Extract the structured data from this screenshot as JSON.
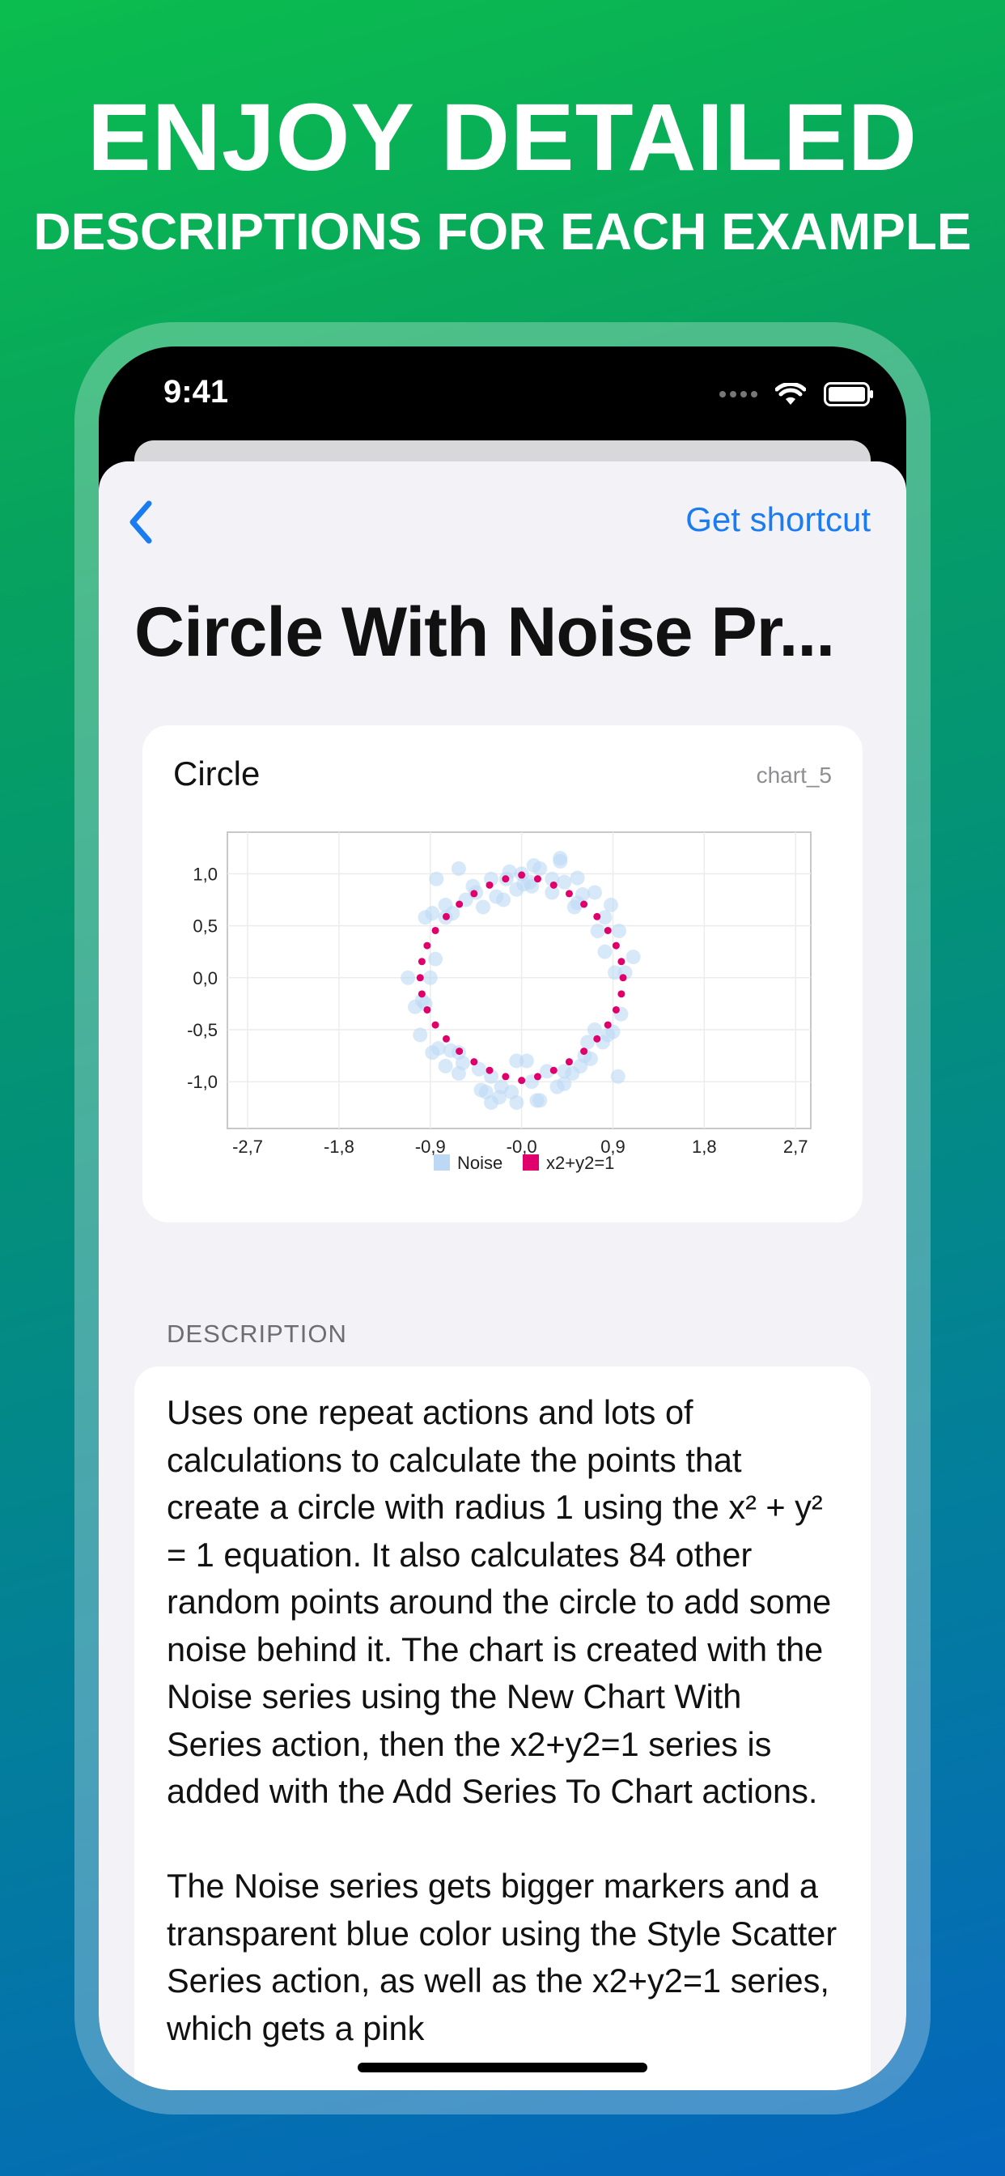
{
  "promo": {
    "title": "ENJOY DETAILED",
    "subtitle": "DESCRIPTIONS FOR EACH EXAMPLE"
  },
  "status_bar": {
    "time": "9:41"
  },
  "nav": {
    "back_icon": "chevron-left-icon",
    "shortcut_label": "Get shortcut"
  },
  "page": {
    "title": "Circle With Noise Pr..."
  },
  "card": {
    "title": "Circle",
    "id_label": "chart_5"
  },
  "colors": {
    "accent": "#1b7cf2",
    "noise": "#bcd8f5",
    "circle": "#e0006c"
  },
  "chart_data": {
    "type": "scatter",
    "title": "",
    "xlabel": "",
    "ylabel": "",
    "xlim": [
      -2.9,
      2.85
    ],
    "ylim": [
      -1.45,
      1.4
    ],
    "x_ticks": [
      -2.7,
      -1.8,
      -0.9,
      0.0,
      0.9,
      1.8,
      2.7
    ],
    "x_tick_labels": [
      "-2,7",
      "-1,8",
      "-0,9",
      "-0,0",
      "0,9",
      "1,8",
      "2,7"
    ],
    "y_ticks": [
      1.0,
      0.5,
      0.0,
      -0.5,
      -1.0
    ],
    "y_tick_labels": [
      "1,0",
      "0,5",
      "0,0",
      "-0,5",
      "-1,0"
    ],
    "grid": true,
    "legend": "bottom-center",
    "series": [
      {
        "name": "Noise",
        "color": "#bcd8f5",
        "x": [
          -0.84,
          -0.62,
          -0.95,
          -0.75,
          -0.45,
          -0.3,
          -0.12,
          0.02,
          0.18,
          0.38,
          0.55,
          0.72,
          0.88,
          0.96,
          0.82,
          0.6,
          0.42,
          0.12,
          -0.05,
          -0.38,
          -0.55,
          -0.85,
          -0.98,
          -1.12,
          -0.82,
          -1.0,
          -1.05,
          -0.75,
          -0.88,
          -0.62,
          -0.4,
          -0.22,
          -0.05,
          0.15,
          0.35,
          0.5,
          0.68,
          0.9,
          0.98,
          0.8,
          0.58,
          0.42,
          0.1,
          -0.2,
          -0.35,
          -0.7,
          -0.95,
          -0.3,
          0.05,
          0.25,
          -0.58,
          0.85,
          1.1,
          1.02,
          -0.15,
          0.3,
          0.55,
          -0.68,
          -0.9,
          0.0,
          0.1,
          0.3,
          0.75,
          0.62,
          0.95,
          -0.48,
          -0.25,
          -0.75,
          -0.62,
          0.42,
          0.72,
          0.82,
          -0.1,
          0.18,
          -0.42,
          0.52,
          -0.88,
          0.92,
          -0.3,
          0.38,
          0.08,
          -0.18,
          0.65,
          -0.05
        ],
        "y": [
          0.95,
          1.05,
          0.58,
          0.7,
          0.82,
          0.95,
          1.02,
          0.9,
          1.05,
          1.12,
          0.96,
          0.82,
          0.7,
          0.45,
          0.58,
          0.8,
          0.92,
          1.08,
          0.85,
          0.68,
          0.75,
          0.18,
          -0.22,
          0.0,
          -0.68,
          -0.55,
          -0.28,
          -0.85,
          -0.72,
          -0.92,
          -1.08,
          -1.15,
          -1.2,
          -1.18,
          -1.05,
          -0.92,
          -0.78,
          -0.52,
          -0.35,
          -0.62,
          -0.85,
          -1.02,
          -1.0,
          -1.05,
          -1.1,
          -0.7,
          -0.25,
          -0.95,
          -0.8,
          -0.9,
          -0.82,
          -0.55,
          0.2,
          0.05,
          0.95,
          0.82,
          0.72,
          0.62,
          0.0,
          1.0,
          0.88,
          0.95,
          0.45,
          -0.75,
          -0.95,
          0.88,
          0.78,
          0.58,
          -0.72,
          -0.9,
          -0.5,
          0.25,
          -1.1,
          -1.18,
          -0.88,
          0.68,
          0.62,
          0.05,
          -1.2,
          1.15,
          0.92,
          0.75,
          -0.62,
          -0.8
        ]
      },
      {
        "name": "x2+y2=1",
        "color": "#e0006c",
        "x": [
          1.0,
          0.983,
          0.931,
          0.85,
          0.743,
          0.614,
          0.469,
          0.316,
          0.158,
          0.0,
          -0.158,
          -0.316,
          -0.469,
          -0.614,
          -0.743,
          -0.85,
          -0.931,
          -0.983,
          -1.0,
          -0.983,
          -0.931,
          -0.85,
          -0.743,
          -0.614,
          -0.469,
          -0.316,
          -0.158,
          0.0,
          0.158,
          0.316,
          0.469,
          0.614,
          0.743,
          0.85,
          0.931,
          0.983
        ],
        "y": [
          0.0,
          0.156,
          0.309,
          0.454,
          0.588,
          0.707,
          0.809,
          0.891,
          0.951,
          0.988,
          0.951,
          0.891,
          0.809,
          0.707,
          0.588,
          0.454,
          0.309,
          0.156,
          0.0,
          -0.156,
          -0.309,
          -0.454,
          -0.588,
          -0.707,
          -0.809,
          -0.891,
          -0.951,
          -0.988,
          -0.951,
          -0.891,
          -0.809,
          -0.707,
          -0.588,
          -0.454,
          -0.309,
          -0.156
        ]
      }
    ]
  },
  "description": {
    "section_label": "DESCRIPTION",
    "paragraph1": "Uses one repeat actions and lots of calculations to calculate the points that create a circle with radius 1 using the x² + y² = 1 equation. It also calculates 84 other random points around the circle to add some noise behind it. The chart is created with the Noise series using the New Chart With Series action, then the x2+y2=1 series is added with the Add Series To Chart actions.",
    "paragraph2": "The Noise series gets bigger markers and a transparent blue color using the Style Scatter Series action, as well as the x2+y2=1 series, which gets a pink"
  }
}
